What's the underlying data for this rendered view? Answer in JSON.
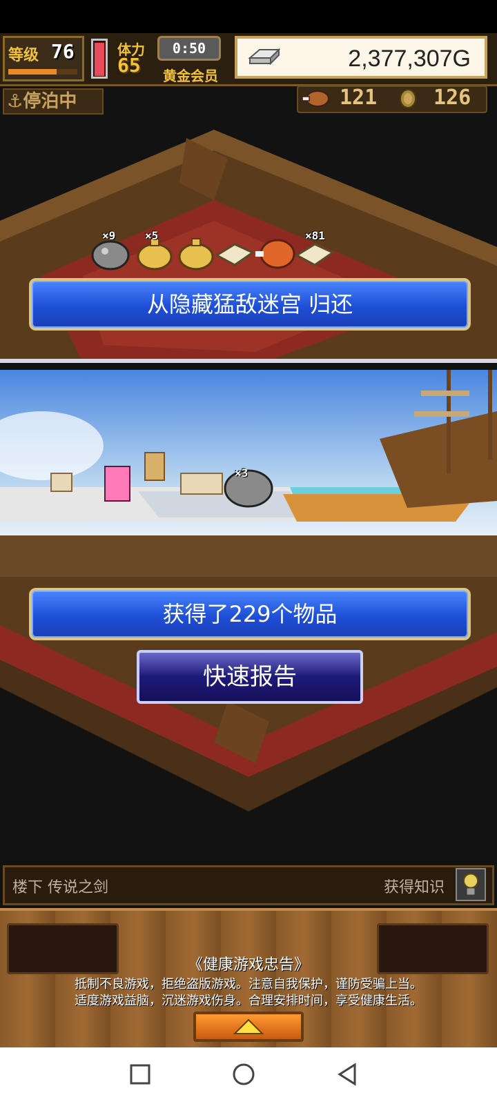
{
  "hud": {
    "level_label": "等级",
    "level_value": "76",
    "level_progress": 0.7,
    "stamina_label": "体力",
    "stamina_value": "65",
    "timer": "0:50",
    "membership": "黄金会员",
    "money": "2,377,307G",
    "status": "停泊中",
    "resource_food": "121",
    "resource_medal": "126"
  },
  "items": [
    {
      "icon": "ore-icon",
      "count": "×9"
    },
    {
      "icon": "gold-sack-icon",
      "count": "×5"
    },
    {
      "icon": "gold-sack-icon",
      "count": ""
    },
    {
      "icon": "cloth-icon",
      "count": ""
    },
    {
      "icon": "meat-icon",
      "count": ""
    },
    {
      "icon": "cloth-icon",
      "count": "×81"
    }
  ],
  "banner1": "从隐藏猛敌迷宫  归还",
  "harbor_item": {
    "icon": "ore-icon",
    "count": "×3"
  },
  "banner2": "获得了229个物品",
  "quick_report": "快速报告",
  "info": {
    "floor": "楼下 传说之剑",
    "knowledge": "获得知识"
  },
  "notice": {
    "title": "《健康游戏忠告》",
    "line1": "抵制不良游戏，拒绝盗版游戏。注意自我保护，谨防受骗上当。",
    "line2": "适度游戏益脑，沉迷游戏伤身。合理安排时间，享受健康生活。"
  },
  "colors": {
    "banner_blue": "#1e4fd6",
    "gold": "#f2c23a",
    "wood": "#8a5a2a"
  }
}
